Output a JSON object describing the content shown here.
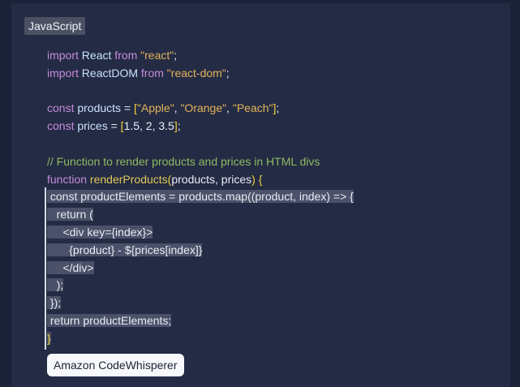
{
  "language_label": "JavaScript",
  "lines": [
    [
      {
        "t": "import",
        "c": "kw"
      },
      {
        "t": " React ",
        "c": "id"
      },
      {
        "t": "from",
        "c": "kw"
      },
      {
        "t": " \"react\"",
        "c": "str"
      },
      {
        "t": ";",
        "c": "op"
      }
    ],
    [
      {
        "t": "import",
        "c": "kw"
      },
      {
        "t": " ReactDOM ",
        "c": "id"
      },
      {
        "t": "from",
        "c": "kw"
      },
      {
        "t": " \"react-dom\"",
        "c": "str"
      },
      {
        "t": ";",
        "c": "op"
      }
    ],
    [],
    [
      {
        "t": "const",
        "c": "kw"
      },
      {
        "t": " products ",
        "c": "id"
      },
      {
        "t": "= ",
        "c": "op"
      },
      {
        "t": "[",
        "c": "br"
      },
      {
        "t": "\"Apple\"",
        "c": "str"
      },
      {
        "t": ", ",
        "c": "op"
      },
      {
        "t": "\"Orange\"",
        "c": "str"
      },
      {
        "t": ", ",
        "c": "op"
      },
      {
        "t": "\"Peach\"",
        "c": "str"
      },
      {
        "t": "]",
        "c": "br"
      },
      {
        "t": ";",
        "c": "op"
      }
    ],
    [
      {
        "t": "const",
        "c": "kw"
      },
      {
        "t": " prices ",
        "c": "id"
      },
      {
        "t": "= ",
        "c": "op"
      },
      {
        "t": "[",
        "c": "br"
      },
      {
        "t": "1.5, 2, 3.5",
        "c": "op"
      },
      {
        "t": "]",
        "c": "br"
      },
      {
        "t": ";",
        "c": "op"
      }
    ],
    [],
    [
      {
        "t": "// Function to render products and prices in HTML divs",
        "c": "cm"
      }
    ],
    [
      {
        "t": "function",
        "c": "kw"
      },
      {
        "t": " renderProducts",
        "c": "fn"
      },
      {
        "t": "(",
        "c": "br"
      },
      {
        "t": "products, prices",
        "c": "op"
      },
      {
        "t": ")",
        "c": "br"
      },
      {
        "t": " {",
        "c": "br"
      }
    ],
    [
      {
        "t": " const productElements = products.map((product, index) => {",
        "c": "op",
        "hl": true
      }
    ],
    [
      {
        "t": "   return (",
        "c": "op",
        "hl": true
      }
    ],
    [
      {
        "t": "     <div key={index}>",
        "c": "op",
        "hl": true
      }
    ],
    [
      {
        "t": "       {product} - ${prices[index]}",
        "c": "op",
        "hl": true
      }
    ],
    [
      {
        "t": "     </div>",
        "c": "op",
        "hl": true
      }
    ],
    [
      {
        "t": "   );",
        "c": "op",
        "hl": true
      }
    ],
    [
      {
        "t": " });",
        "c": "op",
        "hl": true
      }
    ],
    [
      {
        "t": " return productElements;",
        "c": "op",
        "hl": true
      }
    ],
    [
      {
        "t": "}",
        "c": "br",
        "hl": true
      }
    ]
  ],
  "suggestion_tooltip": "Amazon CodeWhisperer",
  "colors": {
    "background": "#1b2238",
    "editor": "#242b44",
    "highlight": "#4a5168",
    "keyword": "#c58bda",
    "string": "#e3b45c",
    "comment": "#8dbb63"
  }
}
